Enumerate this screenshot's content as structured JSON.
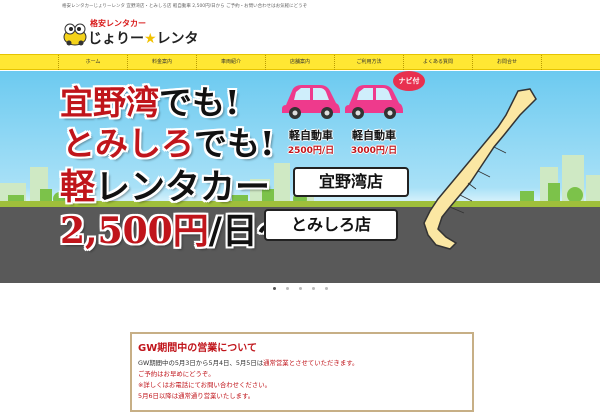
{
  "topbar": {
    "text": "格安レンタカーじょりーレンタ 宜野湾店・とみしろ店 軽自動車 2,500円/日から ご予約・お問い合わせはお気軽にどうぞ"
  },
  "logo": {
    "catch": "格安レンタカー",
    "name_left": "じょりー",
    "star": "★",
    "name_right": "レンタ"
  },
  "nav": {
    "items": [
      "ホーム",
      "料金案内",
      "車両紹介",
      "店舗案内",
      "ご利用方法",
      "よくある質問",
      "お問合せ"
    ]
  },
  "hero": {
    "headline1_red": "宜野湾",
    "headline1_black": "でも!",
    "headline2_red": "とみしろ",
    "headline2_black": "でも!",
    "headline3_red": "軽",
    "headline3_black": "レンタカー",
    "headline4_red": "2,500円",
    "headline4_black": "/日〜",
    "car1": {
      "title": "軽自動車",
      "price": "2500円/日"
    },
    "car2": {
      "title": "軽自動車",
      "price": "3000円/日",
      "badge": "ナビ付"
    },
    "store1": "宜野湾店",
    "store2": "とみしろ店"
  },
  "slider": {
    "count": 5,
    "active": 0
  },
  "notice": {
    "title": "GW期間中の営業について",
    "line1_dark": "GW期間中の5月3日から5月4日、5月5日は",
    "line1_red": "通常営業とさせていただきます。",
    "line2": "ご予約はお早めにどうぞ。",
    "line3": "※詳しくはお電話にてお問い合わせください。",
    "line4": "5月6日以降は通常通り営業いたします。"
  },
  "colors": {
    "accent_red": "#c0151b",
    "nav_yellow": "#ffe733",
    "car_pink": "#ee3a8c",
    "notice_border": "#c7af86"
  }
}
